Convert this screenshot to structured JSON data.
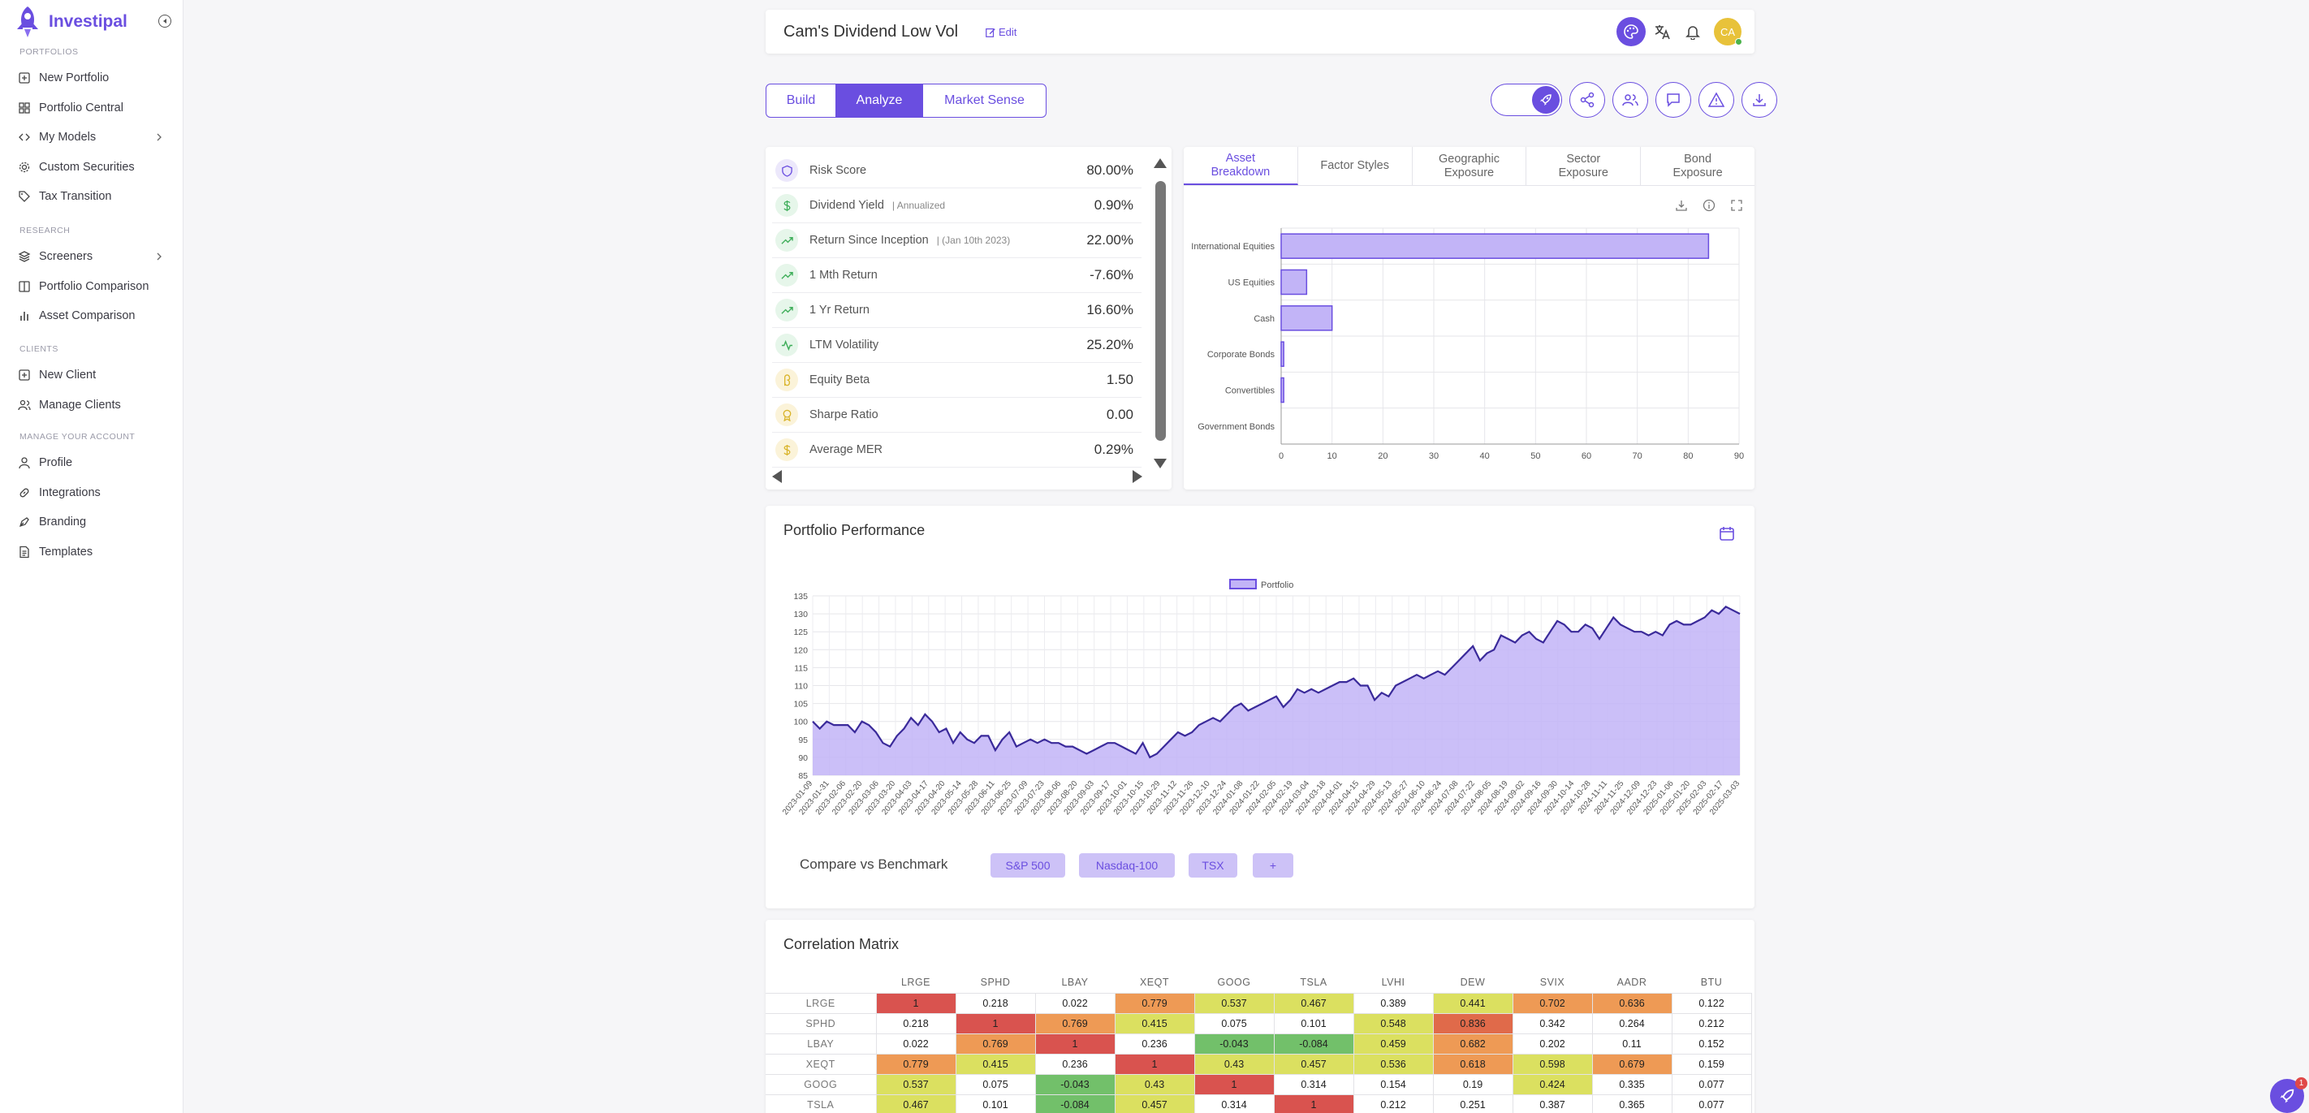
{
  "app": {
    "name": "Investipal",
    "colors": {
      "accent": "#6a4ee0",
      "accent_light": "#cdc2f7",
      "bar_fill": "#c2b4f7",
      "avatar": "#e8c23a"
    }
  },
  "sidebar": {
    "sections": [
      {
        "label": "PORTFOLIOS",
        "items": [
          {
            "label": "New Portfolio",
            "icon": "plus-square-icon"
          },
          {
            "label": "Portfolio Central",
            "icon": "grid-icon"
          },
          {
            "label": "My Models",
            "icon": "code-icon",
            "chevron": true
          },
          {
            "label": "Custom Securities",
            "icon": "gear-icon"
          },
          {
            "label": "Tax Transition",
            "icon": "tag-icon"
          }
        ]
      },
      {
        "label": "RESEARCH",
        "items": [
          {
            "label": "Screeners",
            "icon": "layers-icon",
            "chevron": true
          },
          {
            "label": "Portfolio Comparison",
            "icon": "columns-icon"
          },
          {
            "label": "Asset Comparison",
            "icon": "bar-chart-icon"
          }
        ]
      },
      {
        "label": "CLIENTS",
        "items": [
          {
            "label": "New Client",
            "icon": "plus-square-icon"
          },
          {
            "label": "Manage Clients",
            "icon": "users-icon"
          }
        ]
      },
      {
        "label": "MANAGE YOUR ACCOUNT",
        "items": [
          {
            "label": "Profile",
            "icon": "user-icon"
          },
          {
            "label": "Integrations",
            "icon": "link-icon"
          },
          {
            "label": "Branding",
            "icon": "pen-tool-icon"
          },
          {
            "label": "Templates",
            "icon": "file-text-icon"
          }
        ]
      }
    ]
  },
  "header": {
    "portfolio_title": "Cam's Dividend Low Vol",
    "edit_label": "Edit",
    "avatar_initials": "CA"
  },
  "mode_tabs": [
    {
      "label": "Build",
      "active": false
    },
    {
      "label": "Analyze",
      "active": true
    },
    {
      "label": "Market Sense",
      "active": false
    }
  ],
  "stats": [
    {
      "label": "Risk Score",
      "sub": "",
      "value": "80.00%",
      "icon": "shield-icon",
      "icon_color": "#6a4ee0",
      "icon_bg": "#ece8fb"
    },
    {
      "label": "Dividend Yield",
      "sub": "| Annualized",
      "value": "0.90%",
      "icon": "dollar-icon",
      "icon_color": "#3fae5a",
      "icon_bg": "#e6f6ea"
    },
    {
      "label": "Return Since Inception",
      "sub": "| (Jan 10th 2023)",
      "value": "22.00%",
      "icon": "trending-up-icon",
      "icon_color": "#3fae5a",
      "icon_bg": "#e6f6ea"
    },
    {
      "label": "1 Mth Return",
      "sub": "",
      "value": "-7.60%",
      "icon": "trending-up-icon",
      "icon_color": "#3fae5a",
      "icon_bg": "#e6f6ea"
    },
    {
      "label": "1 Yr Return",
      "sub": "",
      "value": "16.60%",
      "icon": "trending-up-icon",
      "icon_color": "#3fae5a",
      "icon_bg": "#e6f6ea"
    },
    {
      "label": "LTM Volatility",
      "sub": "",
      "value": "25.20%",
      "icon": "activity-icon",
      "icon_color": "#3fae5a",
      "icon_bg": "#e6f6ea"
    },
    {
      "label": "Equity Beta",
      "sub": "",
      "value": "1.50",
      "icon": "beta-icon",
      "icon_color": "#d9b42a",
      "icon_bg": "#fbf3d9"
    },
    {
      "label": "Sharpe Ratio",
      "sub": "",
      "value": "0.00",
      "icon": "award-icon",
      "icon_color": "#d9b42a",
      "icon_bg": "#fbf3d9"
    },
    {
      "label": "Average MER",
      "sub": "",
      "value": "0.29%",
      "icon": "dollar-icon",
      "icon_color": "#d9b42a",
      "icon_bg": "#fbf3d9"
    }
  ],
  "breakdown_tabs": [
    {
      "label": "Asset Breakdown",
      "active": true
    },
    {
      "label": "Factor Styles",
      "active": false
    },
    {
      "label": "Geographic Exposure",
      "active": false
    },
    {
      "label": "Sector Exposure",
      "active": false
    },
    {
      "label": "Bond Exposure",
      "active": false
    }
  ],
  "performance": {
    "title": "Portfolio Performance",
    "compare_label": "Compare vs Benchmark",
    "benchmarks": [
      "S&P 500",
      "Nasdaq-100",
      "TSX",
      "+"
    ]
  },
  "correlation": {
    "title": "Correlation Matrix",
    "columns": [
      "LRGE",
      "SPHD",
      "LBAY",
      "XEQT",
      "GOOG",
      "TSLA",
      "LVHI",
      "DEW",
      "SVIX",
      "AADR",
      "BTU"
    ],
    "rows": [
      {
        "label": "LRGE",
        "values": [
          "1",
          "0.218",
          "0.022",
          "0.779",
          "0.537",
          "0.467",
          "0.389",
          "0.441",
          "0.702",
          "0.636",
          "0.122"
        ]
      },
      {
        "label": "SPHD",
        "values": [
          "0.218",
          "1",
          "0.769",
          "0.415",
          "0.075",
          "0.101",
          "0.548",
          "0.836",
          "0.342",
          "0.264",
          "0.212"
        ]
      },
      {
        "label": "LBAY",
        "values": [
          "0.022",
          "0.769",
          "1",
          "0.236",
          "-0.043",
          "-0.084",
          "0.459",
          "0.682",
          "0.202",
          "0.11",
          "0.152"
        ]
      },
      {
        "label": "XEQT",
        "values": [
          "0.779",
          "0.415",
          "0.236",
          "1",
          "0.43",
          "0.457",
          "0.536",
          "0.618",
          "0.598",
          "0.679",
          "0.159"
        ]
      },
      {
        "label": "GOOG",
        "values": [
          "0.537",
          "0.075",
          "-0.043",
          "0.43",
          "1",
          "0.314",
          "0.154",
          "0.19",
          "0.424",
          "0.335",
          "0.077"
        ]
      },
      {
        "label": "TSLA",
        "values": [
          "0.467",
          "0.101",
          "-0.084",
          "0.457",
          "0.314",
          "1",
          "0.212",
          "0.251",
          "0.387",
          "0.365",
          "0.077"
        ]
      }
    ]
  },
  "help_badge": "1",
  "chart_data": [
    {
      "type": "bar",
      "orientation": "horizontal",
      "categories": [
        "International Equities",
        "US Equities",
        "Cash",
        "Corporate Bonds",
        "Convertibles",
        "Government Bonds"
      ],
      "values": [
        84,
        5,
        10,
        0.5,
        0.5,
        0
      ],
      "xlim": [
        0,
        90
      ],
      "xticks": [
        0,
        10,
        20,
        30,
        40,
        50,
        60,
        70,
        80,
        90
      ],
      "grid": true
    },
    {
      "type": "area",
      "series": [
        {
          "name": "Portfolio"
        }
      ],
      "legend": "top-center",
      "ylim": [
        85,
        135
      ],
      "yticks": [
        85,
        90,
        95,
        100,
        105,
        110,
        115,
        120,
        125,
        130,
        135
      ],
      "xticks": [
        "2023-01-09",
        "2023-01-31",
        "2023-02-06",
        "2023-02-20",
        "2023-03-06",
        "2023-03-20",
        "2023-04-03",
        "2023-04-17",
        "2023-04-20",
        "2023-05-14",
        "2023-05-28",
        "2023-06-11",
        "2023-06-25",
        "2023-07-09",
        "2023-07-23",
        "2023-08-06",
        "2023-08-20",
        "2023-09-03",
        "2023-09-17",
        "2023-10-01",
        "2023-10-15",
        "2023-10-29",
        "2023-11-12",
        "2023-11-26",
        "2023-12-10",
        "2023-12-24",
        "2024-01-08",
        "2024-01-22",
        "2024-02-05",
        "2024-02-19",
        "2024-03-04",
        "2024-03-18",
        "2024-04-01",
        "2024-04-15",
        "2024-04-29",
        "2024-05-13",
        "2024-05-27",
        "2024-06-10",
        "2024-06-24",
        "2024-07-08",
        "2024-07-22",
        "2024-08-05",
        "2024-08-19",
        "2024-09-02",
        "2024-09-16",
        "2024-09-30",
        "2024-10-14",
        "2024-10-28",
        "2024-11-11",
        "2024-11-25",
        "2024-12-09",
        "2024-12-23",
        "2025-01-06",
        "2025-01-20",
        "2025-02-03",
        "2025-02-17",
        "2025-03-03"
      ],
      "values": [
        100,
        98,
        100,
        99,
        99,
        99,
        97,
        100,
        99,
        97,
        94,
        93,
        96,
        98,
        101,
        99,
        102,
        100,
        97,
        98,
        94,
        97,
        95,
        94,
        96,
        96,
        92,
        95,
        97,
        93,
        94,
        95,
        94,
        95,
        94,
        94,
        93,
        93,
        92,
        91,
        92,
        93,
        94,
        94,
        93,
        92,
        91,
        94,
        90,
        91,
        93,
        95,
        97,
        96,
        97,
        99,
        100,
        101,
        100,
        102,
        104,
        105,
        103,
        104,
        105,
        106,
        107,
        104,
        106,
        109,
        108,
        109,
        108,
        109,
        110,
        111,
        111,
        112,
        110,
        110,
        106,
        108,
        107,
        110,
        111,
        112,
        113,
        112,
        113,
        114,
        113,
        115,
        117,
        119,
        121,
        117,
        119,
        120,
        124,
        123,
        122,
        124,
        125,
        123,
        122,
        125,
        128,
        127,
        125,
        125,
        127,
        126,
        123,
        126,
        129,
        127,
        126,
        125,
        125,
        124,
        125,
        124,
        127,
        128,
        127,
        127,
        128,
        129,
        131,
        130,
        132,
        131,
        130
      ]
    }
  ]
}
